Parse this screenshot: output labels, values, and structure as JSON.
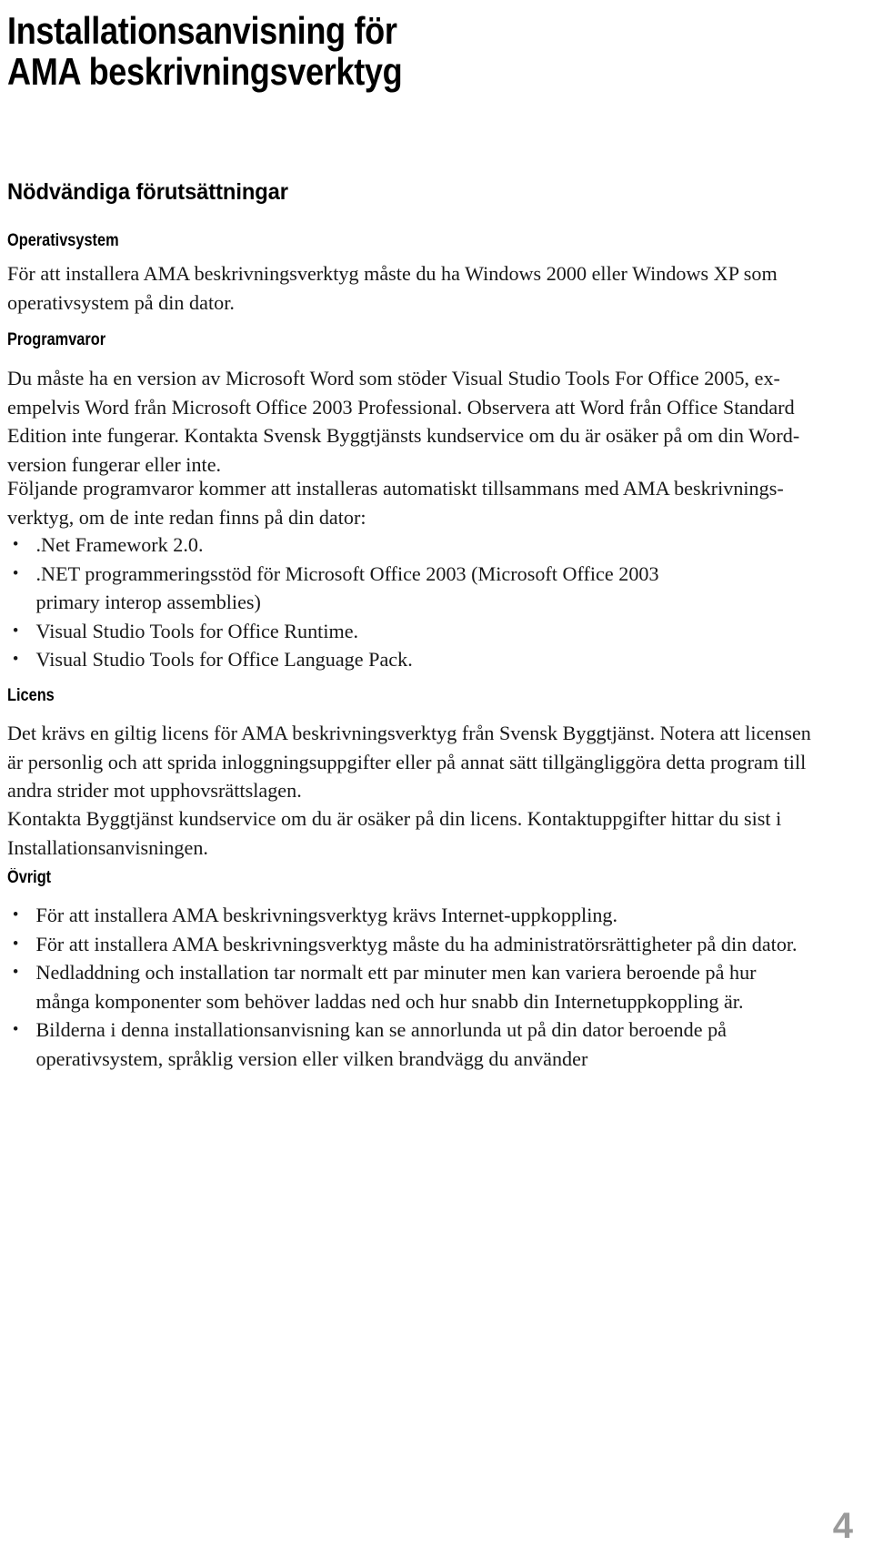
{
  "document": {
    "title_line1": "Installationsanvisning för",
    "title_line2": "AMA beskrivningsverktyg",
    "title": "Installationsanvisning för\nAMA beskrivningsverktyg",
    "page_number": "4"
  },
  "sections": {
    "requirements": {
      "heading": "Nödvändiga förutsättningar",
      "os": {
        "heading": "Operativsystem",
        "paragraph": "För att installera AMA beskrivningsverktyg måste du ha Windows 2000 eller Windows XP som\noperativsystem på din dator."
      },
      "software": {
        "heading": "Programvaror",
        "paragraph_1": "Du måste ha en version av Microsoft Word som stöder Visual Studio Tools For Office 2005, ex-\nempelvis Word från Microsoft Office 2003 Professional. Observera att Word från Office Standard\nEdition inte fungerar. Kontakta Svensk Byggtjänsts kundservice om du är osäker på om din Word-\nversion fungerar eller inte.",
        "paragraph_2": "Följande programvaror kommer att installeras automatiskt tillsammans med AMA beskrivnings-\nverktyg, om de inte redan finns på din dator:",
        "items": [
          ".Net Framework 2.0.",
          ".NET programmeringsstöd för Microsoft Office 2003 (Microsoft Office 2003\nprimary interop assemblies)",
          "Visual Studio Tools for Office Runtime.",
          "Visual Studio Tools for Office Language Pack."
        ]
      }
    },
    "license": {
      "heading": "Licens",
      "paragraph_1": "Det krävs en giltig licens för AMA beskrivningsverktyg från Svensk Byggtjänst. Notera att licensen\när personlig och att sprida inloggningsuppgifter eller på annat sätt tillgängliggöra detta program till\nandra strider mot upphovsrättslagen.",
      "paragraph_2": "Kontakta Byggtjänst kundservice om du är osäker på din licens. Kontaktuppgifter hittar du sist i\nInstallationsanvisningen."
    },
    "other": {
      "heading": "Övrigt",
      "items": [
        "För att installera AMA beskrivningsverktyg krävs Internet-uppkoppling.",
        "För att installera AMA beskrivningsverktyg måste du ha administratörsrättigheter på din dator.",
        "Nedladdning och installation tar normalt ett par minuter men kan variera beroende på hur\nmånga komponenter som behöver laddas ned och hur snabb din Internetuppkoppling är.",
        "Bilderna i denna installationsanvisning kan se annorlunda ut på din dator beroende på\noperativsystem, språklig version eller vilken brandvägg du använder"
      ]
    }
  },
  "colors": {
    "text": "#181818",
    "heading": "#000000",
    "page_number": "#9a9a9a",
    "background": "#ffffff"
  }
}
